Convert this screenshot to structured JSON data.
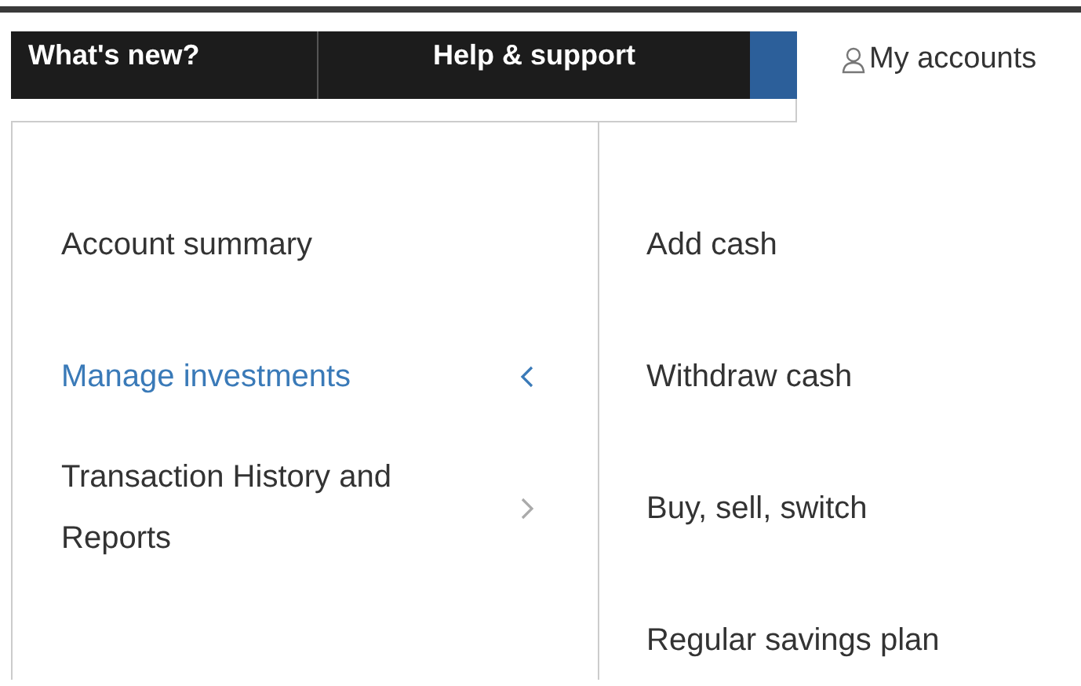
{
  "top_nav": [
    {
      "label": "What's new?"
    },
    {
      "label": "Help & support"
    }
  ],
  "account_link": {
    "label": "My accounts"
  },
  "menu": [
    {
      "label": "Account summary",
      "selected": false,
      "has_submenu": false
    },
    {
      "label": "Manage investments",
      "selected": true,
      "has_submenu": true
    },
    {
      "label": "Transaction History and Reports",
      "selected": false,
      "has_submenu": true
    }
  ],
  "submenu": [
    {
      "label": "Add cash"
    },
    {
      "label": "Withdraw cash"
    },
    {
      "label": "Buy, sell, switch"
    },
    {
      "label": "Regular savings plan"
    }
  ]
}
